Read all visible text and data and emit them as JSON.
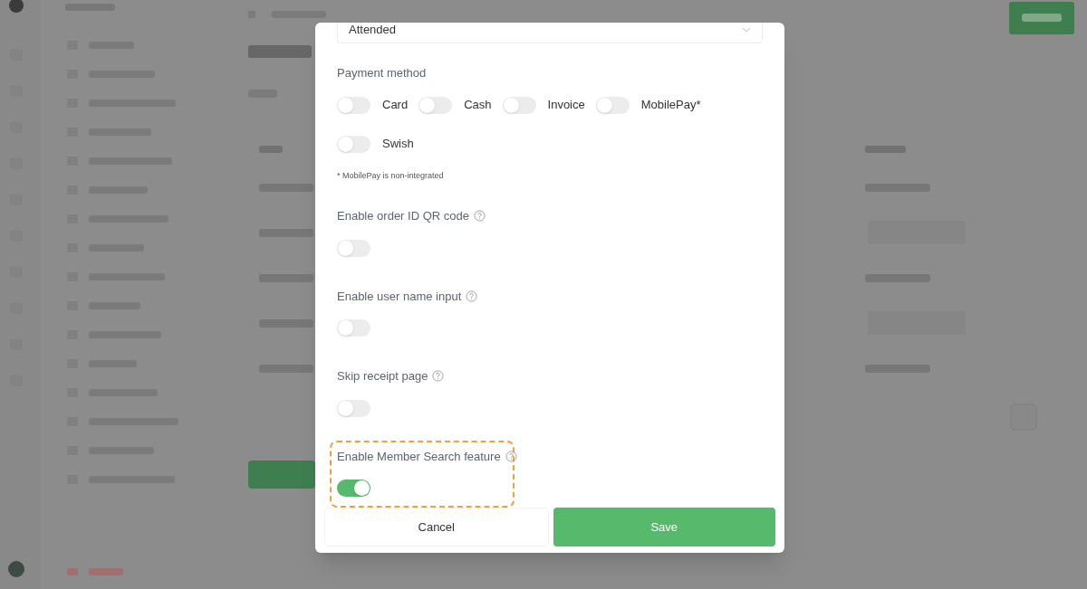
{
  "select": {
    "value": "Attended"
  },
  "payment_method": {
    "label": "Payment method",
    "options": [
      {
        "label": "Card",
        "on": false
      },
      {
        "label": "Cash",
        "on": false
      },
      {
        "label": "Invoice",
        "on": false
      },
      {
        "label": "MobilePay*",
        "on": false
      },
      {
        "label": "Swish",
        "on": false
      }
    ],
    "footnote": "* MobilePay is non-integrated"
  },
  "settings": [
    {
      "label": "Enable order ID QR code",
      "on": false,
      "highlighted": false
    },
    {
      "label": "Enable user name input",
      "on": false,
      "highlighted": false
    },
    {
      "label": "Skip receipt page",
      "on": false,
      "highlighted": false
    },
    {
      "label": "Enable Member Search feature",
      "on": true,
      "highlighted": true
    }
  ],
  "buttons": [
    {
      "label": "Cancel",
      "kind": "secondary"
    },
    {
      "label": "Save",
      "kind": "primary"
    }
  ]
}
